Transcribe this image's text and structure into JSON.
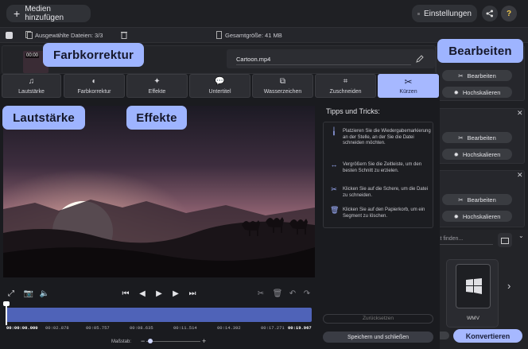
{
  "toolbar": {
    "add_media_label": "Medien hinzufügen",
    "settings_label": "Einstellungen",
    "help_symbol": "?"
  },
  "subbar": {
    "selected_files_label": "Ausgewählte Dateien: 3/3",
    "total_size_label": "Gesamtgröße: 41 MB"
  },
  "file": {
    "name": "Cartoon.mp4",
    "thumb_time": "00:00"
  },
  "sidebar": {
    "edit_label": "Bearbeiten",
    "upscale_label": "Hochskalieren",
    "search_placeholder": "Ist finden...",
    "format_label": "WMV",
    "convert_label": "Konvertieren"
  },
  "tabs": [
    {
      "label": "Lautstärke",
      "icon": "music-icon"
    },
    {
      "label": "Farbkorrektur",
      "icon": "contrast-icon"
    },
    {
      "label": "Effekte",
      "icon": "magic-wand-icon"
    },
    {
      "label": "Untertitel",
      "icon": "speech-bubble-icon"
    },
    {
      "label": "Wasserzeichen",
      "icon": "watermark-icon"
    },
    {
      "label": "Zuschneiden",
      "icon": "crop-icon"
    },
    {
      "label": "Kürzen",
      "icon": "scissors-icon"
    }
  ],
  "tips": {
    "title": "Tipps und Tricks:",
    "items": [
      {
        "icon": "pin-icon",
        "text": "Platzieren Sie die Wiedergabemarkierung an der Stelle, an der Sie die Datei schneiden möchten."
      },
      {
        "icon": "expand-icon",
        "text": "Vergrößern Sie die Zeitleiste, um den besten Schnitt zu erzielen."
      },
      {
        "icon": "scissors-icon",
        "text": "Klicken Sie auf die Schere, um die Datei zu schneiden."
      },
      {
        "icon": "trash-icon",
        "text": "Klicken Sie auf den Papierkorb, um ein Segment zu löschen."
      }
    ]
  },
  "actions": {
    "reset_label": "Zurücksetzen",
    "save_close_label": "Speichern und schließen"
  },
  "timeline": {
    "times": [
      "00:00:00.000",
      "00:02.878",
      "00:05.757",
      "00:08.635",
      "00:11.514",
      "00:14.392",
      "00:17.271",
      "00:19.967"
    ],
    "zoom_label": "Maßstab:"
  },
  "callouts": {
    "color": "Farbkorrektur",
    "edit": "Bearbeiten",
    "volume": "Lautstärke",
    "effects": "Effekte"
  },
  "colors": {
    "accent": "#a6b8ff",
    "background": "#1f2024",
    "timeline_track": "#4f63b8"
  }
}
